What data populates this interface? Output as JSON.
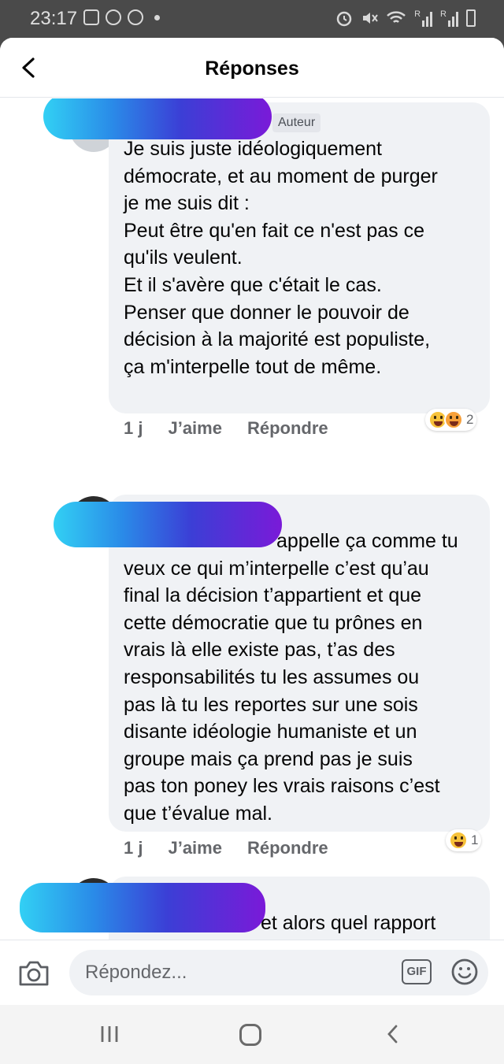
{
  "status_bar": {
    "time": "23:17",
    "icons": [
      "gallery-icon",
      "messenger-icon",
      "whatsapp-icon",
      "dot-icon",
      "alarm-icon",
      "mute-icon",
      "wifi-icon",
      "signal-icon",
      "signal-icon",
      "battery-icon"
    ],
    "signal_label_1": "R",
    "signal_label_2": "R"
  },
  "header": {
    "title": "Réponses",
    "back_icon": "chevron-left-icon"
  },
  "comments": [
    {
      "badge": "Auteur",
      "text": "Je suis juste idéologiquement\ndémocrate, et au moment de purger\nje me suis dit :\nPeut être qu'en fait ce n'est pas ce\nqu'ils veulent.\nEt il s'avère que c'était le cas.\nPenser que donner le pouvoir de\ndécision à la majorité est populiste,\nça m'interpelle tout de même.",
      "time": "1 j",
      "like_label": "J’aime",
      "reply_label": "Répondre",
      "reactions": [
        "laugh-emoji-icon",
        "wow-emoji-icon"
      ],
      "reaction_count": "2"
    },
    {
      "text": "appelle ça comme tu\nveux ce qui m’interpelle c’est qu’au\nfinal la décision t’appartient et que\ncette démocratie que tu prônes en\nvrais là elle existe pas, t’as des\nresponsabilités tu les assumes ou\npas là tu les reportes sur une sois\ndisante idéologie humaniste et un\ngroupe mais ça prend pas je suis\npas ton poney les vrais raisons c’est\nque t’évalue mal.",
      "time": "1 j",
      "like_label": "J’aime",
      "reply_label": "Répondre",
      "reactions": [
        "laugh-emoji-icon"
      ],
      "reaction_count": "1"
    },
    {
      "text": "et alors quel rapport\nentre ta croyance sa confiance la\ntolérance des autres et cet ersatz de"
    }
  ],
  "composer": {
    "placeholder": "Répondez...",
    "gif_label": "GIF",
    "camera_icon": "camera-icon",
    "emoji_icon": "smiley-icon"
  },
  "nav": {
    "icons": [
      "recents-icon",
      "home-icon",
      "back-icon"
    ]
  },
  "colors": {
    "bubble": "#f0f2f5",
    "meta_text": "#65676b",
    "redaction_start": "#32d0f4",
    "redaction_end": "#7a1ad8"
  }
}
